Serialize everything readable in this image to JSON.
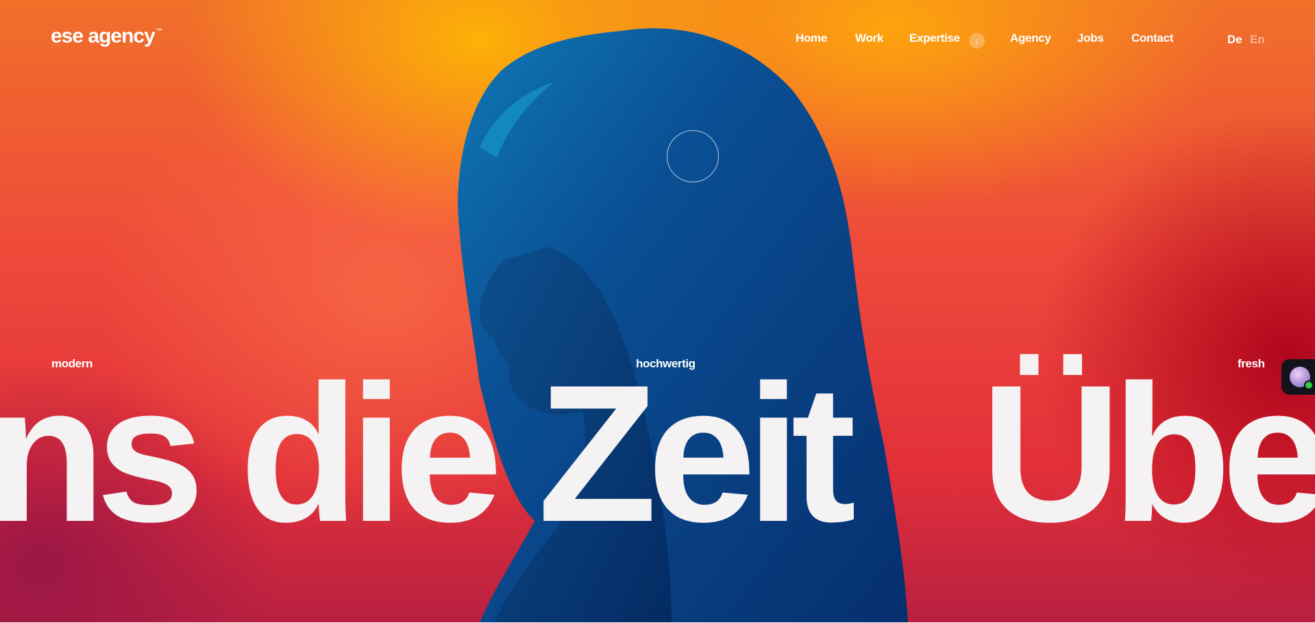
{
  "header": {
    "logo_text": "ese agency",
    "logo_tm": "™",
    "nav": {
      "home": "Home",
      "work": "Work",
      "expertise": "Expertise",
      "agency": "Agency",
      "jobs": "Jobs",
      "contact": "Contact"
    },
    "expertise_arrow_icon": "arrow-down-icon",
    "languages": {
      "de": "De",
      "en": "En",
      "active": "De"
    }
  },
  "hero": {
    "tags": {
      "left": "modern",
      "center": "hochwertig",
      "right": "fresh"
    },
    "marquee_text": "ns die Zeit   Überhe",
    "image_icon": "woman-silhouette-image"
  },
  "chat_widget": {
    "icon": "chat-avatar-icon",
    "status": "online"
  },
  "colors": {
    "text": "#ffffff",
    "headline": "#f4f2f2",
    "silhouette": "#0a3f86",
    "gradient_top": "#f6a800",
    "gradient_mid": "#ee4a3a",
    "gradient_bottom": "#b82040"
  }
}
